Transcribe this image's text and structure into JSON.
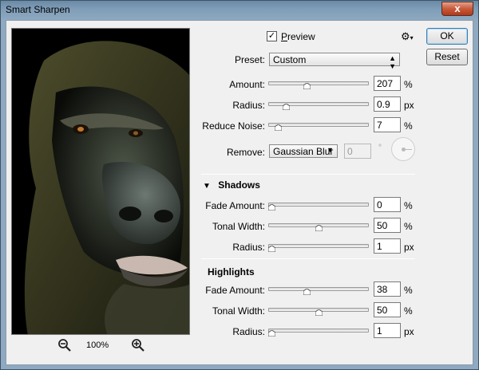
{
  "window": {
    "title": "Smart Sharpen",
    "close_label": "x"
  },
  "buttons": {
    "ok": "OK",
    "reset": "Reset"
  },
  "preview": {
    "checkbox_label": "Preview",
    "checked": "✓",
    "zoom_level": "100%"
  },
  "preset": {
    "label": "Preset:",
    "value": "Custom"
  },
  "sharpen": {
    "amount": {
      "label": "Amount:",
      "value": "207",
      "unit": "%",
      "slider_fraction": 0.38
    },
    "radius": {
      "label": "Radius:",
      "value": "0.9",
      "unit": "px",
      "slider_fraction": 0.15
    },
    "reduce_noise": {
      "label": "Reduce Noise:",
      "value": "7",
      "unit": "%",
      "slider_fraction": 0.07
    },
    "remove": {
      "label": "Remove:",
      "value": "Gaussian Blur",
      "angle": "0",
      "angle_unit": "°"
    }
  },
  "shadows": {
    "title": "Shadows",
    "fade_amount": {
      "label": "Fade Amount:",
      "value": "0",
      "unit": "%",
      "slider_fraction": 0.0
    },
    "tonal_width": {
      "label": "Tonal Width:",
      "value": "50",
      "unit": "%",
      "slider_fraction": 0.5
    },
    "radius": {
      "label": "Radius:",
      "value": "1",
      "unit": "px",
      "slider_fraction": 0.0
    }
  },
  "highlights": {
    "title": "Highlights",
    "fade_amount": {
      "label": "Fade Amount:",
      "value": "38",
      "unit": "%",
      "slider_fraction": 0.38
    },
    "tonal_width": {
      "label": "Tonal Width:",
      "value": "50",
      "unit": "%",
      "slider_fraction": 0.5
    },
    "radius": {
      "label": "Radius:",
      "value": "1",
      "unit": "px",
      "slider_fraction": 0.0
    }
  },
  "icons": {
    "zoom_out": "zoom-out-icon",
    "zoom_in": "zoom-in-icon",
    "gear": "gear-icon",
    "collapse": "triangle-down-icon",
    "dropdown": "dropdown-arrows-icon"
  },
  "colors": {
    "accent_default_button": "#3c7fb1",
    "title_bar": "#7f9db7",
    "close_button": "#c75a3a"
  }
}
